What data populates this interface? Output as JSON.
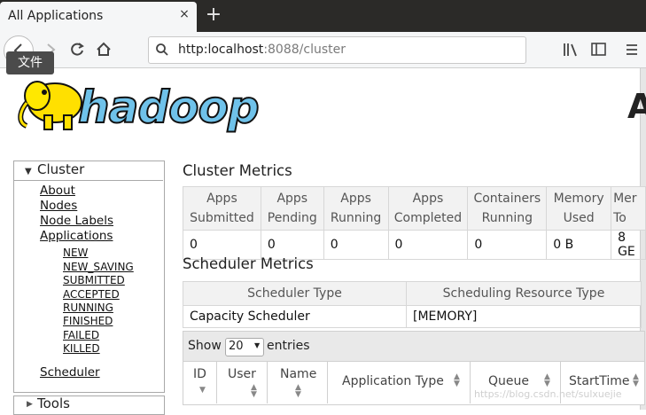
{
  "browser": {
    "tab_title": "All Applications",
    "tab_close": "×",
    "new_tab": "+",
    "url_host": "http:localhost",
    "url_rest": ":8088/cluster",
    "tooltip": "文件"
  },
  "page": {
    "logo_text": "hadoop",
    "partial_title": "A"
  },
  "sidebar": {
    "cluster_label": "Cluster",
    "links": [
      "About",
      "Nodes",
      "Node Labels",
      "Applications"
    ],
    "app_states": [
      "NEW",
      "NEW_SAVING",
      "SUBMITTED",
      "ACCEPTED",
      "RUNNING",
      "FINISHED",
      "FAILED",
      "KILLED"
    ],
    "scheduler": "Scheduler",
    "tools_label": "Tools"
  },
  "cluster_metrics": {
    "title": "Cluster Metrics",
    "headers": [
      [
        "Apps",
        "Submitted"
      ],
      [
        "Apps",
        "Pending"
      ],
      [
        "Apps",
        "Running"
      ],
      [
        "Apps",
        "Completed"
      ],
      [
        "Containers",
        "Running"
      ],
      [
        "Memory",
        "Used"
      ],
      [
        "Mer",
        "To"
      ]
    ],
    "values": [
      "0",
      "0",
      "0",
      "0",
      "0",
      "0 B",
      "8 GE"
    ]
  },
  "scheduler_metrics": {
    "title": "Scheduler Metrics",
    "headers": [
      "Scheduler Type",
      "Scheduling Resource Type"
    ],
    "values": [
      "Capacity Scheduler",
      "[MEMORY]"
    ]
  },
  "apps_table": {
    "show_label": "Show",
    "entries_value": "20",
    "entries_label": "entries",
    "columns": [
      "ID",
      "User",
      "Name",
      "Application Type",
      "Queue",
      "StartTime"
    ]
  },
  "watermark": "https://blog.csdn.net/sulxuejie"
}
